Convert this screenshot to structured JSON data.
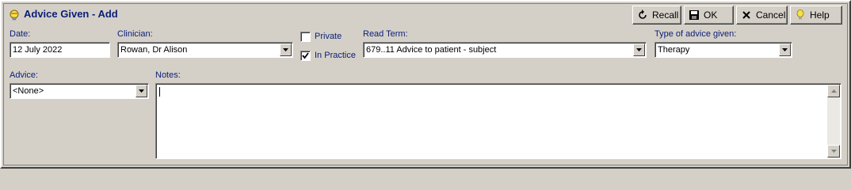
{
  "window": {
    "title": "Advice Given - Add",
    "title_icon": "advice-bulb-icon"
  },
  "toolbar": {
    "recall": {
      "label": "Recall",
      "icon": "recall-arrow-icon"
    },
    "ok": {
      "label": "OK",
      "icon": "save-disk-icon"
    },
    "cancel": {
      "label": "Cancel",
      "icon": "close-x-icon"
    },
    "help": {
      "label": "Help",
      "icon": "help-bulb-icon"
    }
  },
  "form": {
    "date": {
      "label": "Date:",
      "value": "12 July 2022"
    },
    "clinician": {
      "label": "Clinician:",
      "value": "Rowan, Dr Alison"
    },
    "private": {
      "label": "Private",
      "checked": false
    },
    "in_practice": {
      "label": "In Practice",
      "checked": true
    },
    "read_term": {
      "label": "Read Term:",
      "value": "679..11 Advice to patient - subject"
    },
    "advice_type": {
      "label": "Type of advice given:",
      "value": "Therapy"
    },
    "advice": {
      "label": "Advice:",
      "value": "<None>"
    },
    "notes": {
      "label": "Notes:",
      "value": ""
    }
  },
  "colors": {
    "window_bg": "#d4d0c8",
    "label_text": "#0a1e78",
    "title_text": "#0a1e78"
  }
}
